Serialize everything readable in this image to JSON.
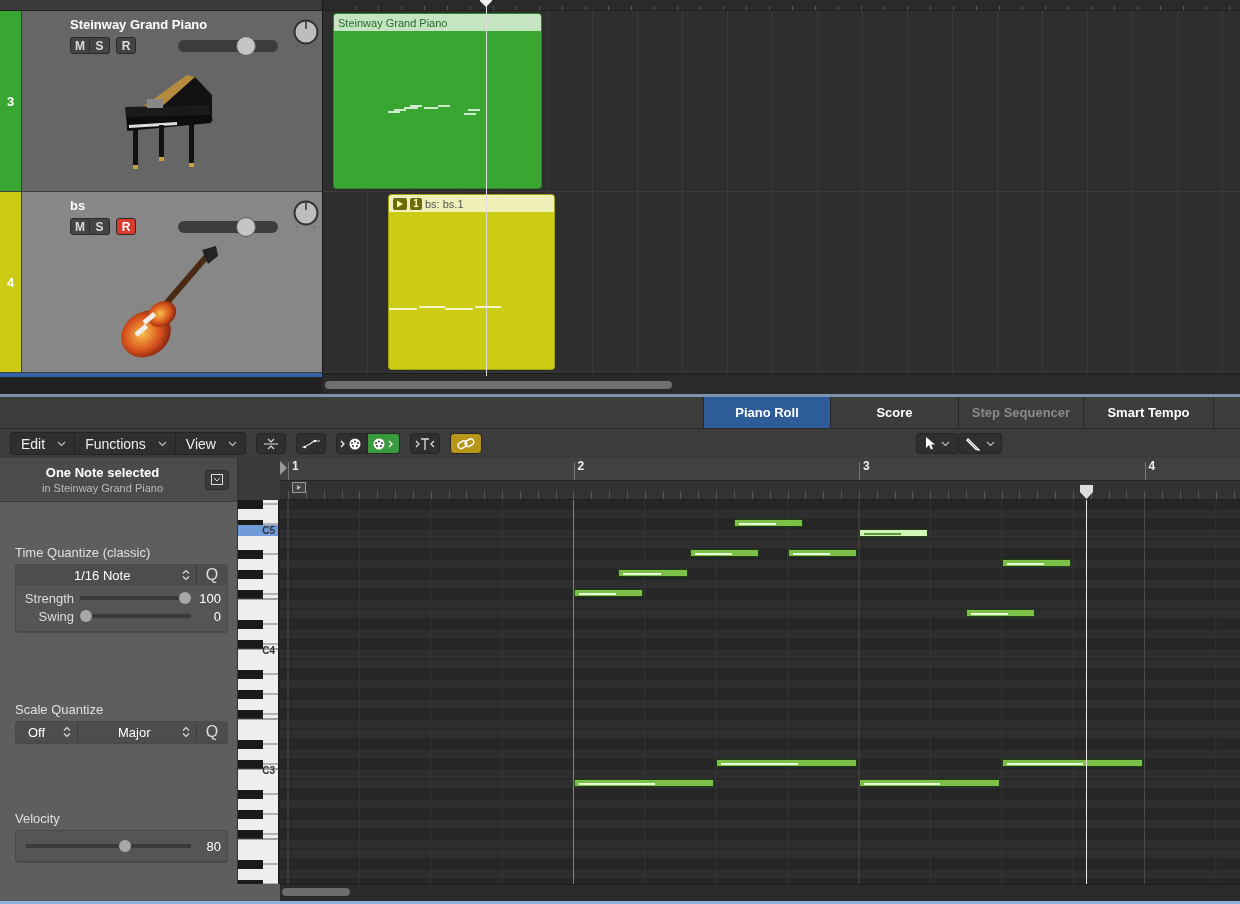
{
  "arrange": {
    "tracks": [
      {
        "number": "3",
        "color": "#3aa632",
        "name": "Steinway Grand Piano",
        "selected": false,
        "buttons": [
          {
            "label": "M",
            "on": false
          },
          {
            "label": "S",
            "on": false
          },
          {
            "label": "R",
            "on": false
          }
        ],
        "volume": {
          "level": 0.72
        },
        "kind": "piano",
        "region": {
          "name": "Steinway Grand Piano"
        }
      },
      {
        "number": "4",
        "color": "#cccc14",
        "name": "bs",
        "selected": true,
        "buttons": [
          {
            "label": "M",
            "on": false
          },
          {
            "label": "S",
            "on": false
          },
          {
            "label": "R",
            "on": true
          }
        ],
        "volume": {
          "level": 0.72
        },
        "kind": "guitar",
        "region": {
          "number": "1",
          "name": "bs: bs.1"
        }
      }
    ]
  },
  "editor": {
    "tabs": [
      {
        "label": "Piano Roll",
        "selected": true,
        "disabled": false
      },
      {
        "label": "Score",
        "selected": false,
        "disabled": false
      },
      {
        "label": "Step Sequencer",
        "selected": false,
        "disabled": true
      },
      {
        "label": "Smart Tempo",
        "selected": false,
        "disabled": false
      }
    ],
    "menus": [
      "Edit",
      "Functions",
      "View"
    ],
    "toolbar": {
      "midi_in": {
        "on": false
      },
      "midi_out": {
        "on": true
      },
      "link": {
        "on": true
      }
    },
    "inspector": {
      "title": "One Note selected",
      "subtitle": "in Steinway Grand Piano",
      "time_quantize": {
        "label": "Time Quantize (classic)",
        "value": "1/16 Note",
        "button": "Q",
        "sliders": [
          {
            "label": "Strength",
            "level": 1,
            "reading": "100"
          },
          {
            "label": "Swing",
            "level": 0,
            "reading": "0"
          }
        ]
      },
      "scale_quantize": {
        "label": "Scale Quantize",
        "mode": "Off",
        "scale": "Major",
        "button": "Q"
      },
      "velocity": {
        "label": "Velocity",
        "level": 0.61,
        "reading": "80"
      }
    },
    "ruler": {
      "bars": [
        "1",
        "2",
        "3",
        "4"
      ]
    },
    "keyboard": {
      "labels": [
        {
          "label": "C5",
          "highlighted": true
        },
        {
          "label": "C4",
          "highlighted": false
        },
        {
          "label": "C3",
          "highlighted": false
        }
      ]
    },
    "notes": [
      {
        "selected": false
      },
      {
        "selected": false
      },
      {
        "selected": false
      },
      {
        "selected": false
      },
      {
        "selected": false
      },
      {
        "selected": true
      },
      {
        "selected": false
      },
      {
        "selected": false
      },
      {
        "selected": false
      },
      {
        "selected": false
      },
      {
        "selected": false
      },
      {
        "selected": false
      }
    ]
  }
}
